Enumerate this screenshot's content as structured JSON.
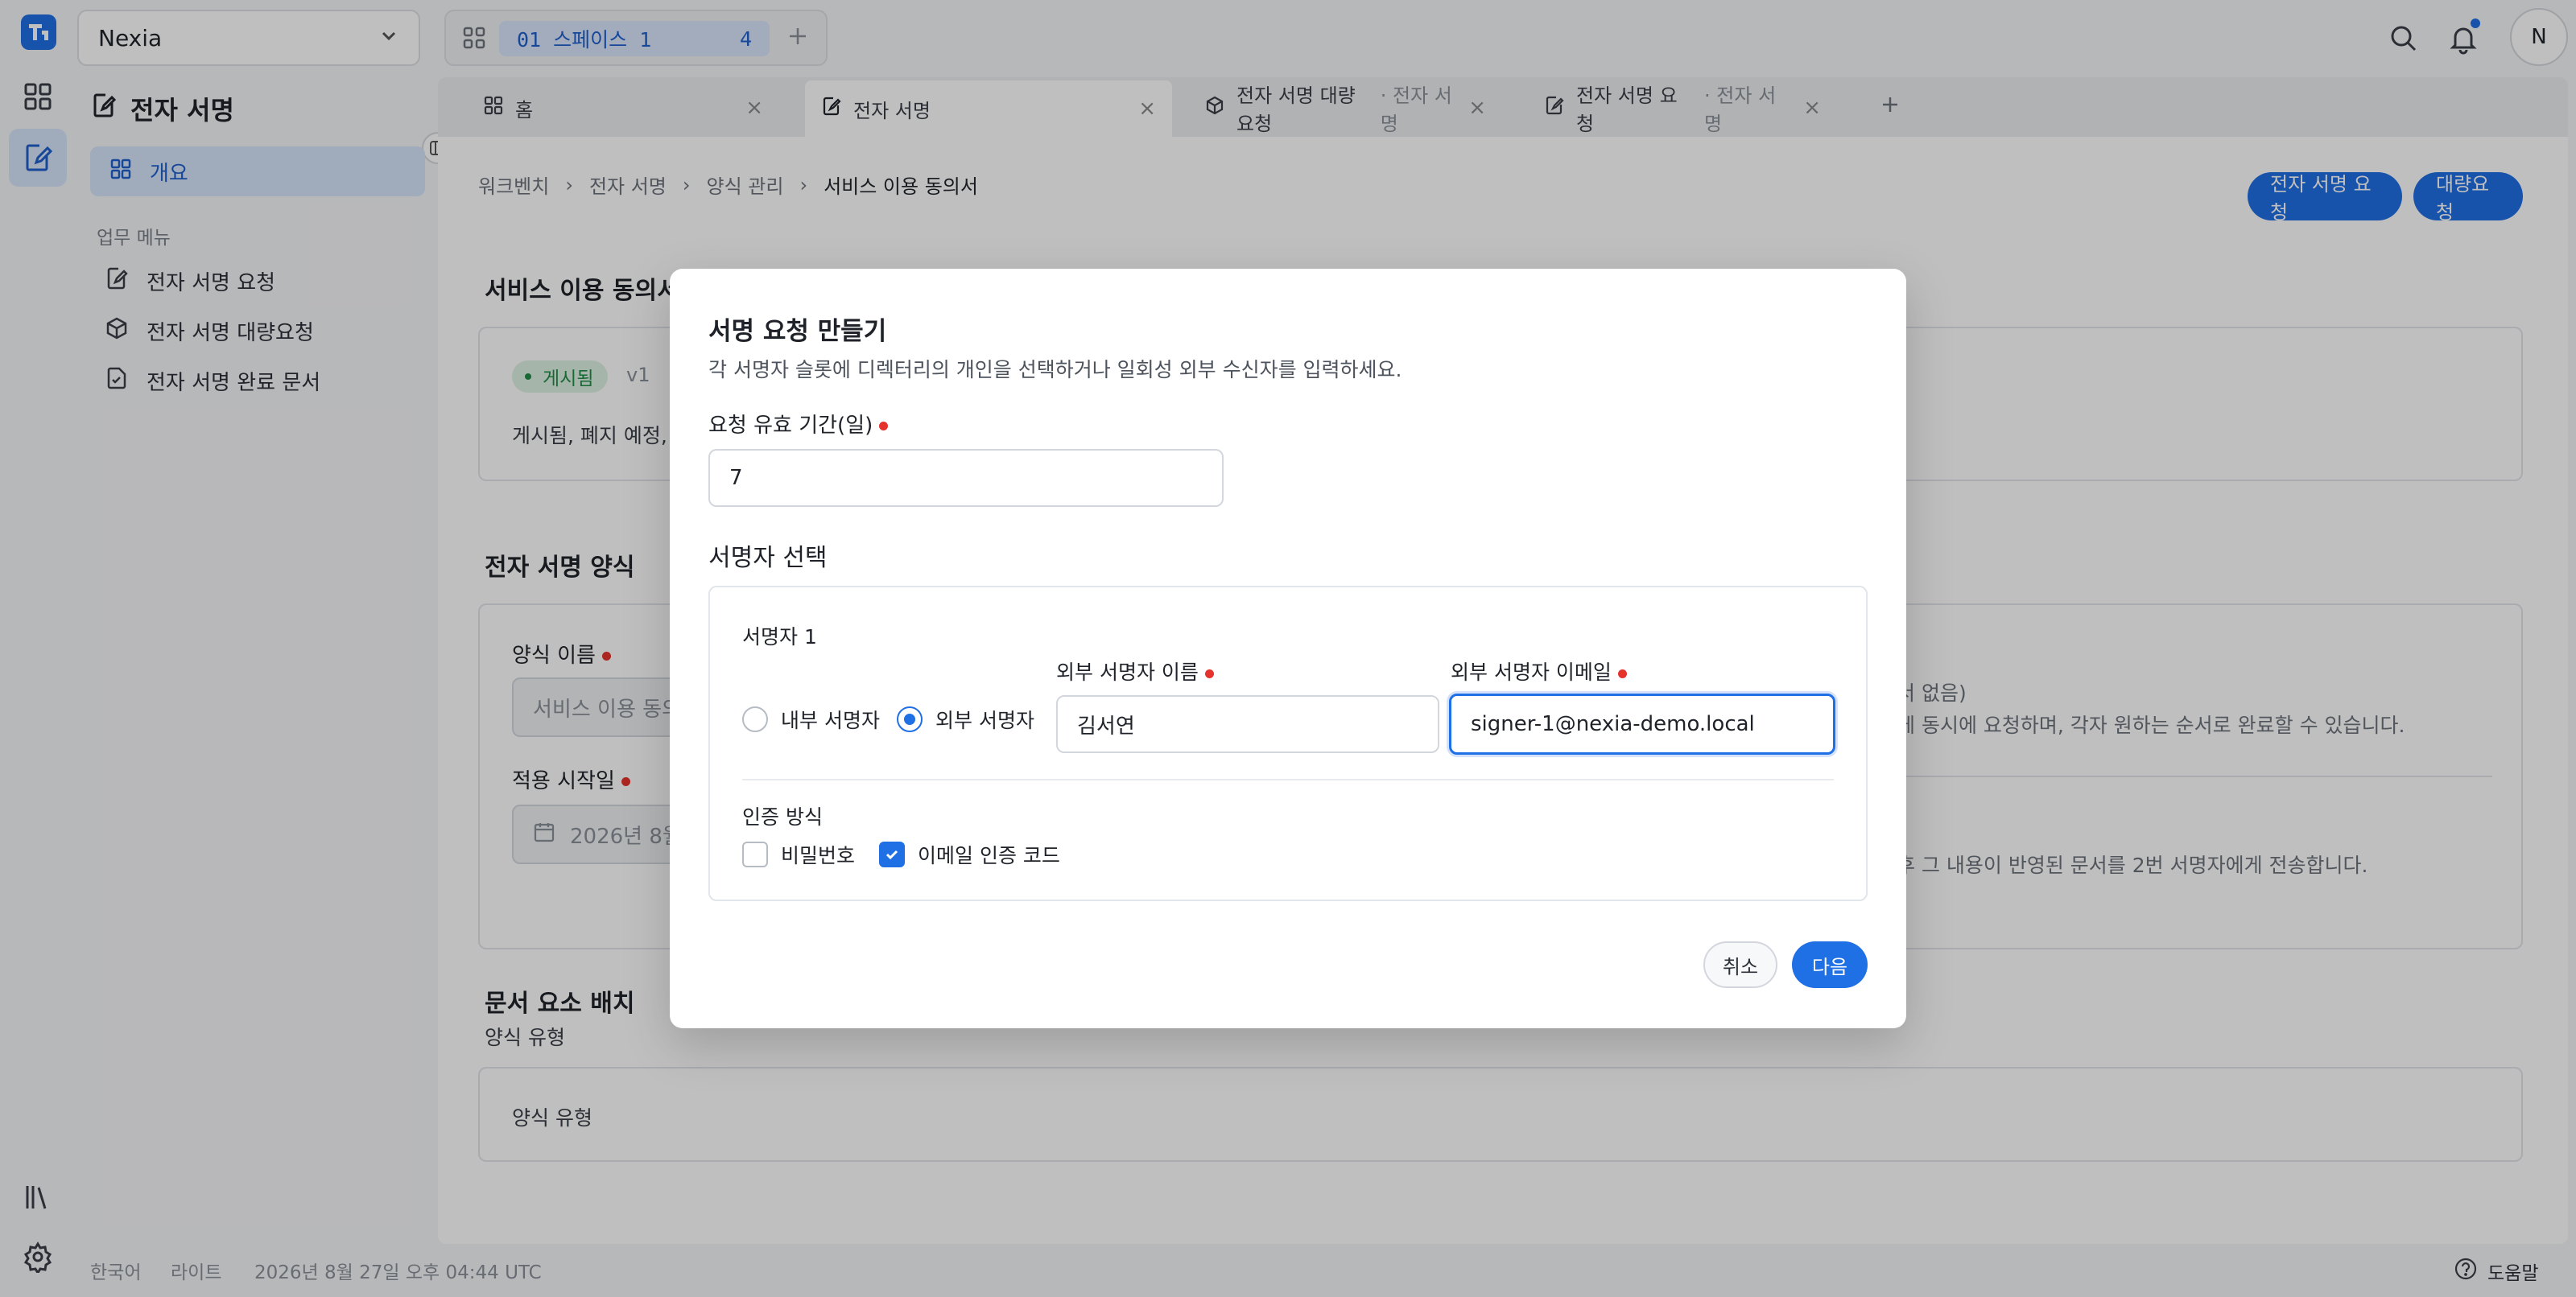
{
  "header": {
    "workspace": "Nexia",
    "space_label": "01 스페이스 1",
    "space_count": "4",
    "avatar": "N"
  },
  "sidebar": {
    "title": "전자 서명",
    "overview": "개요",
    "section_label": "업무 메뉴",
    "items": [
      {
        "label": "전자 서명 요청",
        "icon": "document-edit-icon"
      },
      {
        "label": "전자 서명 대량요청",
        "icon": "cube-icon"
      },
      {
        "label": "전자 서명 완료 문서",
        "icon": "document-check-icon"
      }
    ]
  },
  "tabs": [
    {
      "label": "홈",
      "sub": ""
    },
    {
      "label": "전자 서명",
      "sub": ""
    },
    {
      "label": "전자 서명 대량요청",
      "sub": "· 전자 서명"
    },
    {
      "label": "전자 서명 요청",
      "sub": "· 전자 서명"
    }
  ],
  "breadcrumb": [
    "워크벤치",
    "전자 서명",
    "양식 관리",
    "서비스 이용 동의서"
  ],
  "actions": {
    "request": "전자 서명 요청",
    "bulk": "대량요청"
  },
  "background": {
    "section1_title": "서비스 이용 동의서",
    "badge": "게시됨",
    "version": "v1",
    "status_text": "게시됨, 폐지 예정, :",
    "section2_title": "전자 서명 양식",
    "form_name_label": "양식 이름",
    "form_name_value": "서비스 이용 동의",
    "start_date_label": "적용 시작일",
    "start_date_value": "2026년 8월",
    "right_text_1": "서 없음)",
    "right_text_2": "게 동시에 요청하며, 각자 원하는 순서로 완료할 수 있습니다.",
    "right_text_3": "후 그 내용이 반영된 문서를 2번 서명자에게 전송합니다.",
    "section3_title": "문서 요소 배치",
    "section3_sub": "양식 유형",
    "section3_card": "양식 유형"
  },
  "footer": {
    "language": "한국어",
    "theme": "라이트",
    "datetime": "2026년 8월 27일 오후 04:44 UTC",
    "help": "도움말"
  },
  "modal": {
    "title": "서명 요청 만들기",
    "description": "각 서명자 슬롯에 디렉터리의 개인을 선택하거나 일회성 외부 수신자를 입력하세요.",
    "validity_label": "요청 유효 기간(일)",
    "validity_value": "7",
    "signer_select_title": "서명자 선택",
    "signer_title": "서명자 1",
    "internal_label": "내부 서명자",
    "external_label": "외부 서명자",
    "external_name_label": "외부 서명자 이름",
    "external_name_value": "김서연",
    "external_email_label": "외부 서명자 이메일",
    "external_email_value": "signer-1@nexia-demo.local",
    "auth_title": "인증 방식",
    "auth_password": "비밀번호",
    "auth_email_code": "이메일 인증 코드",
    "cancel": "취소",
    "next": "다음"
  },
  "colors": {
    "accent": "#1f6fe5",
    "required": "#e5322d",
    "badge_bg": "#ddf2e3",
    "badge_text": "#218c47"
  }
}
